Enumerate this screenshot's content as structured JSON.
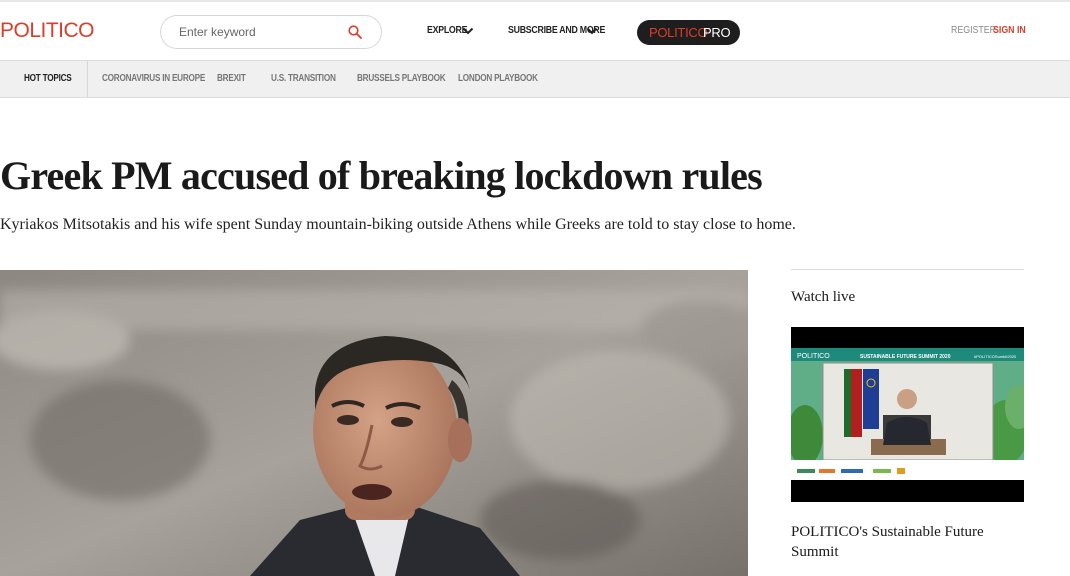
{
  "brand": {
    "logo": "POLITICO",
    "accent": "#dc3d2a"
  },
  "search": {
    "placeholder": "Enter keyword",
    "value": "",
    "icon": "search-icon"
  },
  "nav": {
    "explore": "EXPLORE",
    "subscribe": "SUBSCRIBE AND MORE",
    "pro_part1": "POLITICO",
    "pro_part2": "PRO",
    "register": "REGISTER",
    "signin": "SIGN IN"
  },
  "topics": {
    "hot": "HOT TOPICS",
    "items": [
      "CORONAVIRUS IN EUROPE",
      "BREXIT",
      "U.S. TRANSITION",
      "BRUSSELS PLAYBOOK",
      "LONDON PLAYBOOK"
    ]
  },
  "article": {
    "headline": "Greek PM accused of breaking lockdown rules",
    "dek": "Kyriakos Mitsotakis and his wife spent Sunday mountain-biking outside Athens while Greeks are told to stay close to home."
  },
  "sidebar": {
    "watch_title": "Watch live",
    "video_caption": "POLITICO's Sustainable Future Summit",
    "video_banner_left": "POLITICO",
    "video_banner_center": "SUSTAINABLE FUTURE SUMMIT 2020",
    "video_banner_right": "#POLITICOSumbit2020"
  }
}
